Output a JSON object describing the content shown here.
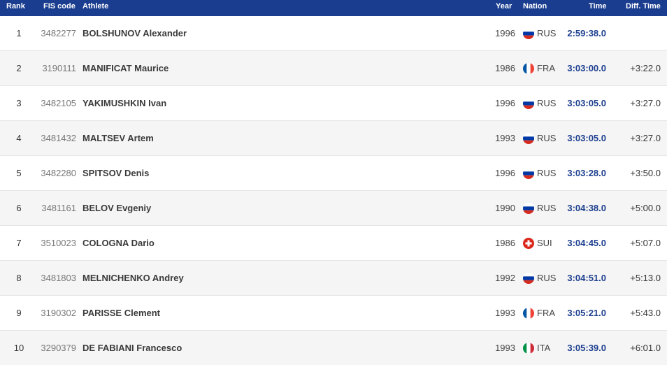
{
  "header": {
    "rank": "Rank",
    "fis_code": "FIS code",
    "athlete": "Athlete",
    "year": "Year",
    "nation": "Nation",
    "time": "Time",
    "diff_time": "Diff. Time"
  },
  "rows": [
    {
      "rank": "1",
      "fis_code": "3482277",
      "athlete": "BOLSHUNOV Alexander",
      "year": "1996",
      "flag": "RUS",
      "nation": "RUS",
      "time": "2:59:38.0",
      "diff": ""
    },
    {
      "rank": "2",
      "fis_code": "3190111",
      "athlete": "MANIFICAT Maurice",
      "year": "1986",
      "flag": "FRA",
      "nation": "FRA",
      "time": "3:03:00.0",
      "diff": "+3:22.0"
    },
    {
      "rank": "3",
      "fis_code": "3482105",
      "athlete": "YAKIMUSHKIN Ivan",
      "year": "1996",
      "flag": "RUS",
      "nation": "RUS",
      "time": "3:03:05.0",
      "diff": "+3:27.0"
    },
    {
      "rank": "4",
      "fis_code": "3481432",
      "athlete": "MALTSEV Artem",
      "year": "1993",
      "flag": "RUS",
      "nation": "RUS",
      "time": "3:03:05.0",
      "diff": "+3:27.0"
    },
    {
      "rank": "5",
      "fis_code": "3482280",
      "athlete": "SPITSOV Denis",
      "year": "1996",
      "flag": "RUS",
      "nation": "RUS",
      "time": "3:03:28.0",
      "diff": "+3:50.0"
    },
    {
      "rank": "6",
      "fis_code": "3481161",
      "athlete": "BELOV Evgeniy",
      "year": "1990",
      "flag": "RUS",
      "nation": "RUS",
      "time": "3:04:38.0",
      "diff": "+5:00.0"
    },
    {
      "rank": "7",
      "fis_code": "3510023",
      "athlete": "COLOGNA Dario",
      "year": "1986",
      "flag": "SUI",
      "nation": "SUI",
      "time": "3:04:45.0",
      "diff": "+5:07.0"
    },
    {
      "rank": "8",
      "fis_code": "3481803",
      "athlete": "MELNICHENKO Andrey",
      "year": "1992",
      "flag": "RUS",
      "nation": "RUS",
      "time": "3:04:51.0",
      "diff": "+5:13.0"
    },
    {
      "rank": "9",
      "fis_code": "3190302",
      "athlete": "PARISSE Clement",
      "year": "1993",
      "flag": "FRA",
      "nation": "FRA",
      "time": "3:05:21.0",
      "diff": "+5:43.0"
    },
    {
      "rank": "10",
      "fis_code": "3290379",
      "athlete": "DE FABIANI Francesco",
      "year": "1993",
      "flag": "ITA",
      "nation": "ITA",
      "time": "3:05:39.0",
      "diff": "+6:01.0"
    }
  ],
  "colors": {
    "header_bg": "#1a3d8f",
    "time_text": "#1d3f8f",
    "row_alt": "#f5f5f5"
  }
}
